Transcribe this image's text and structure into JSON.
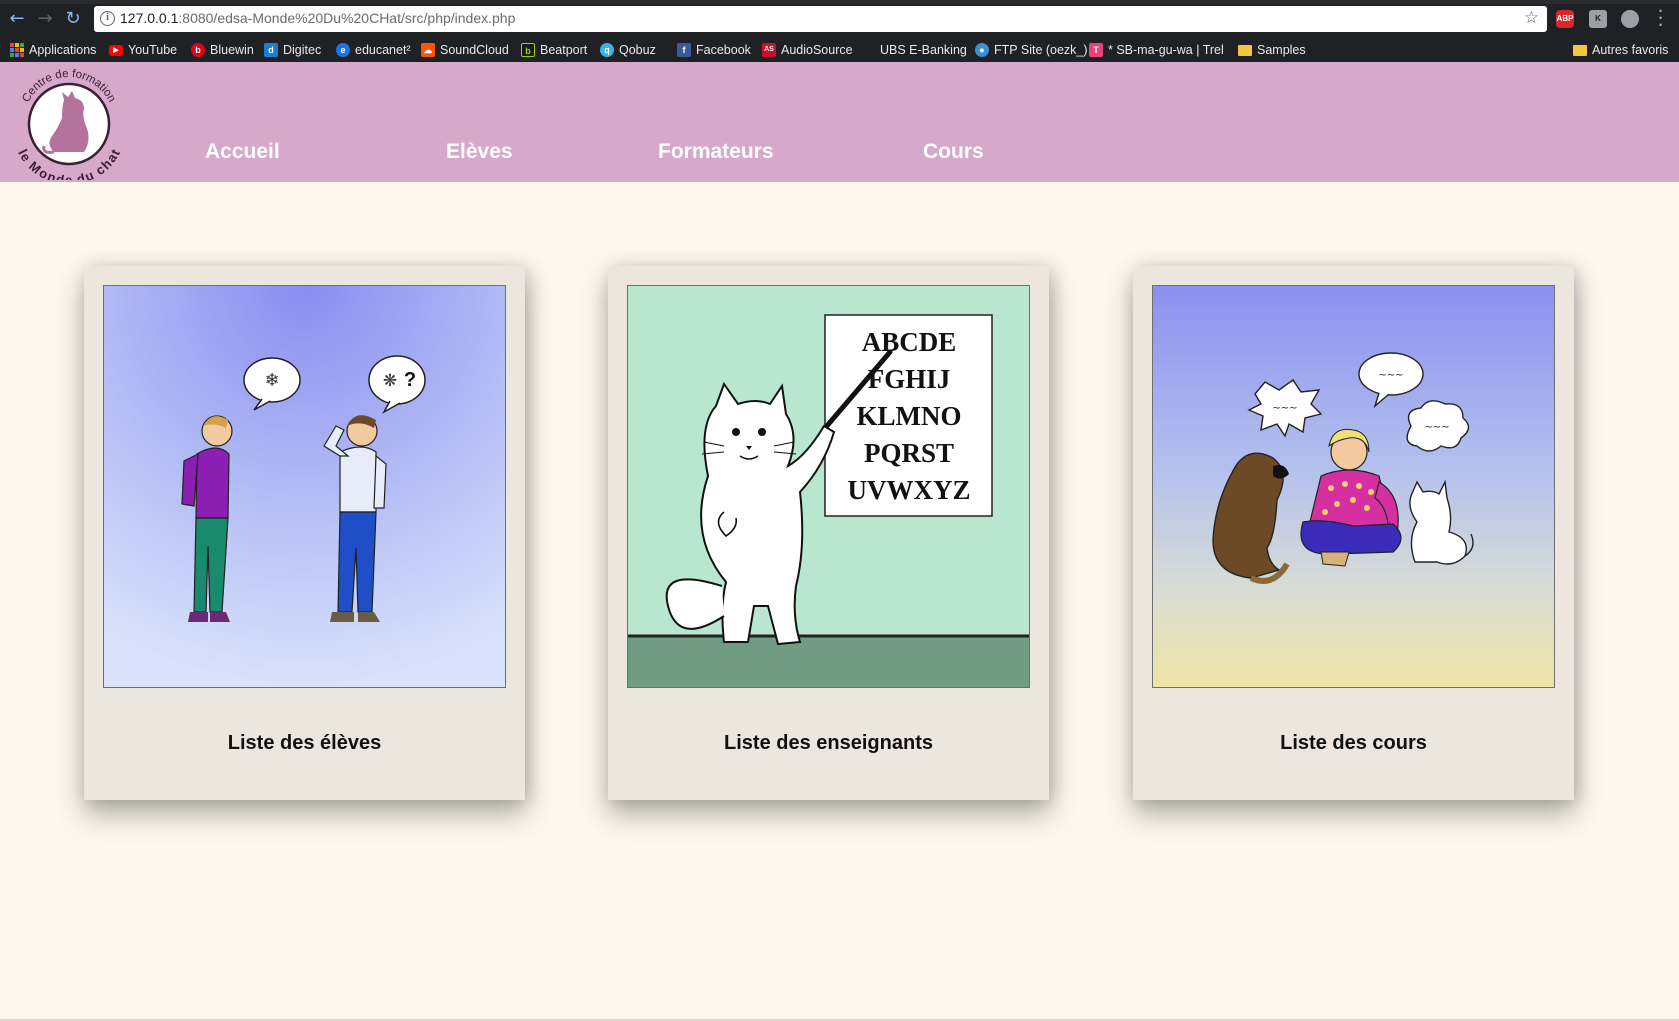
{
  "browser": {
    "url_host": "127.0.0.1",
    "url_rest": ":8080/edsa-Monde%20Du%20CHat/src/php/index.php",
    "bookmarks": [
      {
        "label": "Applications",
        "icon": "apps-grid-icon"
      },
      {
        "label": "YouTube",
        "icon": "youtube-icon",
        "color": "#ff0000"
      },
      {
        "label": "Bluewin",
        "icon": "bluewin-icon",
        "color": "#e2001a"
      },
      {
        "label": "Digitec",
        "icon": "digitec-icon",
        "color": "#1b7fd3"
      },
      {
        "label": "educanet²",
        "icon": "educanet-icon",
        "color": "#1a73e8"
      },
      {
        "label": "SoundCloud",
        "icon": "soundcloud-icon",
        "color": "#ff5500"
      },
      {
        "label": "Beatport",
        "icon": "beatport-icon",
        "color": "#94d500"
      },
      {
        "label": "Qobuz",
        "icon": "qobuz-icon",
        "color": "#37b6e6"
      },
      {
        "label": "Facebook",
        "icon": "facebook-icon",
        "color": "#3b5998"
      },
      {
        "label": "AudioSource",
        "icon": "audiosource-icon",
        "color": "#c8102e"
      },
      {
        "label": "UBS E-Banking",
        "icon": "ubs-icon",
        "color": "#202124"
      },
      {
        "label": "FTP Site (oezk_)",
        "icon": "ftp-icon",
        "color": "#3d8fd1"
      },
      {
        "label": "* SB-ma-gu-wa | Trell",
        "icon": "trello-icon",
        "color": "#e8407a"
      },
      {
        "label": "Samples",
        "icon": "folder-icon"
      }
    ],
    "other_bookmarks": "Autres favoris",
    "ext_abp": "ABP",
    "ext_k": "K"
  },
  "site": {
    "logo_top_text": "Centre de formation",
    "logo_bottom_text": "le Monde du chat",
    "menu": [
      "Accueil",
      "Elèves",
      "Formateurs",
      "Cours"
    ]
  },
  "cards": [
    {
      "caption": "Liste des élèves",
      "image": "two-students-talking-illustration"
    },
    {
      "caption": "Liste des enseignants",
      "image": "cat-teacher-alphabet-chart-illustration"
    },
    {
      "caption": "Liste des cours",
      "image": "girl-with-dog-and-cat-illustration"
    }
  ],
  "chart_letters": [
    "ABCDE",
    "FGHIJ",
    "KLMNO",
    "PQRST",
    "UVWXYZ"
  ],
  "colors": {
    "header_bg": "#d6a8c9",
    "page_bg": "#fcf8ee",
    "card_bg": "#ece6de"
  }
}
